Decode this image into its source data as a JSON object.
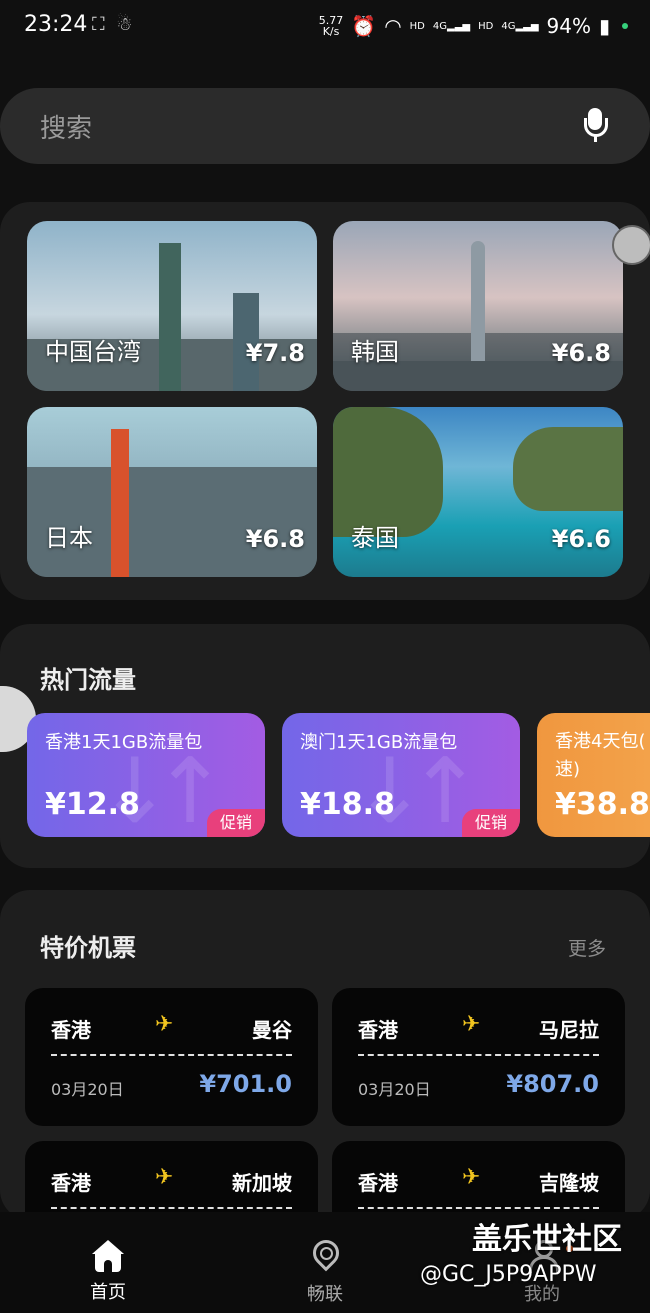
{
  "status_bar": {
    "time": "23:24",
    "net_speed_value": "5.77",
    "net_speed_unit": "K/s",
    "hd1": "HD",
    "sig1": "4G",
    "hd2": "HD",
    "sig2": "4G",
    "battery": "94%"
  },
  "search": {
    "placeholder": "搜索"
  },
  "destinations": [
    {
      "name": "中国台湾",
      "price": "¥7.8"
    },
    {
      "name": "韩国",
      "price": "¥6.8"
    },
    {
      "name": "日本",
      "price": "¥6.8"
    },
    {
      "name": "泰国",
      "price": "¥6.6"
    }
  ],
  "hot_data": {
    "title": "热门流量",
    "packages": [
      {
        "name": "香港1天1GB流量包",
        "price": "¥12.8",
        "tag": "促销"
      },
      {
        "name": "澳门1天1GB流量包",
        "price": "¥18.8",
        "tag": "促销"
      },
      {
        "name": "香港4天包(",
        "name_line2": "速)",
        "price": "¥38.8"
      }
    ]
  },
  "flights": {
    "title": "特价机票",
    "more": "更多",
    "tickets": [
      {
        "from": "香港",
        "to": "曼谷",
        "date": "03月20日",
        "price": "¥701.0"
      },
      {
        "from": "香港",
        "to": "马尼拉",
        "date": "03月20日",
        "price": "¥807.0"
      },
      {
        "from": "香港",
        "to": "新加坡"
      },
      {
        "from": "香港",
        "to": "吉隆坡"
      }
    ]
  },
  "bottom_nav": [
    {
      "label": "首页",
      "active": true
    },
    {
      "label": "畅联",
      "active": false
    },
    {
      "label": "我的",
      "active": false
    }
  ],
  "watermark": {
    "line1": "盖乐世社区",
    "line2": "@GC_J5P9APPW"
  },
  "colors": {
    "accent_price": "#7ea8e8",
    "promo": "#e8407c",
    "plane": "#f2c51f"
  }
}
